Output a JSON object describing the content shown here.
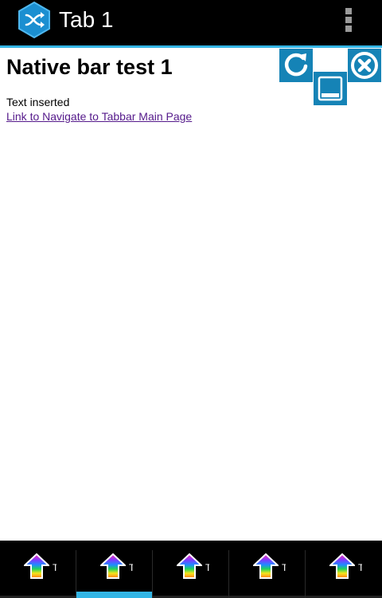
{
  "action_bar": {
    "title": "Tab 1",
    "app_icon": "shuffle-hexagon-icon",
    "menu_icon": "overflow-menu-icon",
    "accent_color": "#33b5e5"
  },
  "content": {
    "heading": "Native bar test 1",
    "text": "Text inserted",
    "link": "Link to Navigate to Tabbar Main Page"
  },
  "controls": {
    "refresh_icon": "refresh-icon",
    "minimize_icon": "minimize-icon",
    "close_icon": "close-icon",
    "button_color": "#1583b6"
  },
  "tabs": [
    {
      "label": "T",
      "icon": "rainbow-up-arrow-icon",
      "selected": false
    },
    {
      "label": "T",
      "icon": "rainbow-up-arrow-icon",
      "selected": true
    },
    {
      "label": "T",
      "icon": "rainbow-up-arrow-icon",
      "selected": false
    },
    {
      "label": "T",
      "icon": "rainbow-up-arrow-icon",
      "selected": false
    },
    {
      "label": "T",
      "icon": "rainbow-up-arrow-icon",
      "selected": false
    }
  ]
}
